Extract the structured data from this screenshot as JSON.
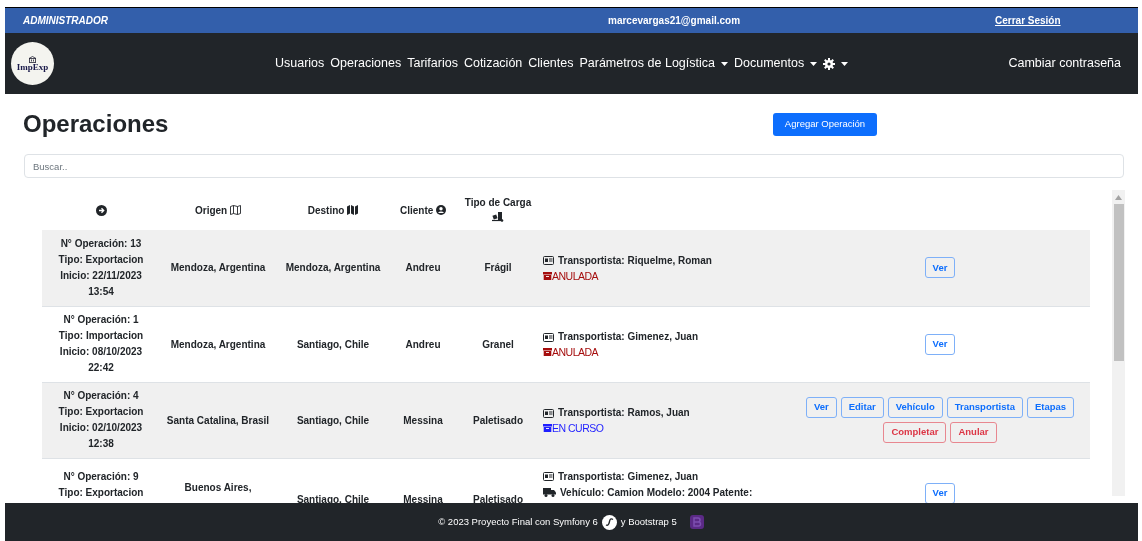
{
  "top_bar": {
    "role": "ADMINISTRADOR",
    "email": "marcevargas21@gmail.com",
    "logout": "Cerrar Sesión"
  },
  "navbar": {
    "logo_text": "ImpExp",
    "links": [
      {
        "kind": "text",
        "label": "Usuarios",
        "dropdown": false
      },
      {
        "kind": "text",
        "label": "Operaciones",
        "dropdown": false
      },
      {
        "kind": "text",
        "label": "Tarifarios",
        "dropdown": false
      },
      {
        "kind": "text",
        "label": "Cotización",
        "dropdown": false
      },
      {
        "kind": "text",
        "label": "Clientes",
        "dropdown": false
      },
      {
        "kind": "text",
        "label": "Parámetros de Logística",
        "dropdown": true
      },
      {
        "kind": "text",
        "label": "Documentos",
        "dropdown": true
      },
      {
        "kind": "gear",
        "dropdown": true
      }
    ],
    "account_link": "Cambiar contraseña"
  },
  "page": {
    "title": "Operaciones",
    "add_button": "Agregar Operación",
    "search": {
      "placeholder": "Buscar.."
    }
  },
  "table": {
    "columns": [
      "Origen",
      "Destino",
      "Cliente",
      "Tipo de Carga"
    ],
    "rows": [
      {
        "info": [
          "**N° Operación:** 13",
          "**Tipo:** Exportacion",
          "**Inicio:** 22/11/2023 13:54"
        ],
        "origen": "Mendoza, Argentina",
        "destino": "Mendoza, Argentina",
        "cliente": "Andreu",
        "carga": "Frágil",
        "details": [
          {
            "kind": "transportista",
            "text": "**Transportista:** Riquelme, Roman"
          }
        ],
        "status": {
          "kind": "anulada",
          "label": "ANULADA"
        },
        "actions": [
          {
            "label": "Ver",
            "kind": "primary"
          }
        ]
      },
      {
        "info": [
          "**N° Operación:** 1",
          "**Tipo:** Importacion",
          "**Inicio:** 08/10/2023 22:42"
        ],
        "origen": "Mendoza, Argentina",
        "destino": "Santiago, Chile",
        "cliente": "Andreu",
        "carga": "Granel",
        "details": [
          {
            "kind": "transportista",
            "text": "**Transportista:** Gimenez, Juan"
          }
        ],
        "status": {
          "kind": "anulada",
          "label": "ANULADA"
        },
        "actions": [
          {
            "label": "Ver",
            "kind": "primary"
          }
        ]
      },
      {
        "info": [
          "**N° Operación:** 4",
          "**Tipo:** Exportacion",
          "**Inicio:** 02/10/2023 12:38"
        ],
        "origen": "Santa Catalina, Brasil",
        "destino": "Santiago, Chile",
        "cliente": "Messina",
        "carga": "Paletisado",
        "details": [
          {
            "kind": "transportista",
            "text": "**Transportista:** Ramos, Juan"
          }
        ],
        "status": {
          "kind": "en_curso",
          "label": "EN CURSO"
        },
        "actions": [
          {
            "label": "Ver",
            "kind": "primary"
          },
          {
            "label": "Editar",
            "kind": "primary"
          },
          {
            "label": "Vehículo",
            "kind": "primary"
          },
          {
            "label": "Transportista",
            "kind": "primary"
          },
          {
            "label": "Etapas",
            "kind": "primary"
          },
          {
            "label": "Completar",
            "kind": "danger"
          },
          {
            "label": "Anular",
            "kind": "danger"
          }
        ]
      },
      {
        "info": [
          "**N° Operación:** 9",
          "**Tipo:** Exportacion"
        ],
        "origen": "Buenos Aires,",
        "destino": "Santiago, Chile",
        "cliente": "Messina",
        "carga": "Paletisado",
        "details": [
          {
            "kind": "transportista",
            "text": "**Transportista:** Gimenez, Juan"
          },
          {
            "kind": "vehiculo",
            "text": "**Vehículo:** Camion Modelo: 2004 Patente:"
          }
        ],
        "actions": [
          {
            "label": "Ver",
            "kind": "primary"
          }
        ]
      }
    ]
  },
  "footer": {
    "text_before": "© 2023 Proyecto Final con Symfony 6",
    "text_after": "y Bootstrap 5"
  }
}
